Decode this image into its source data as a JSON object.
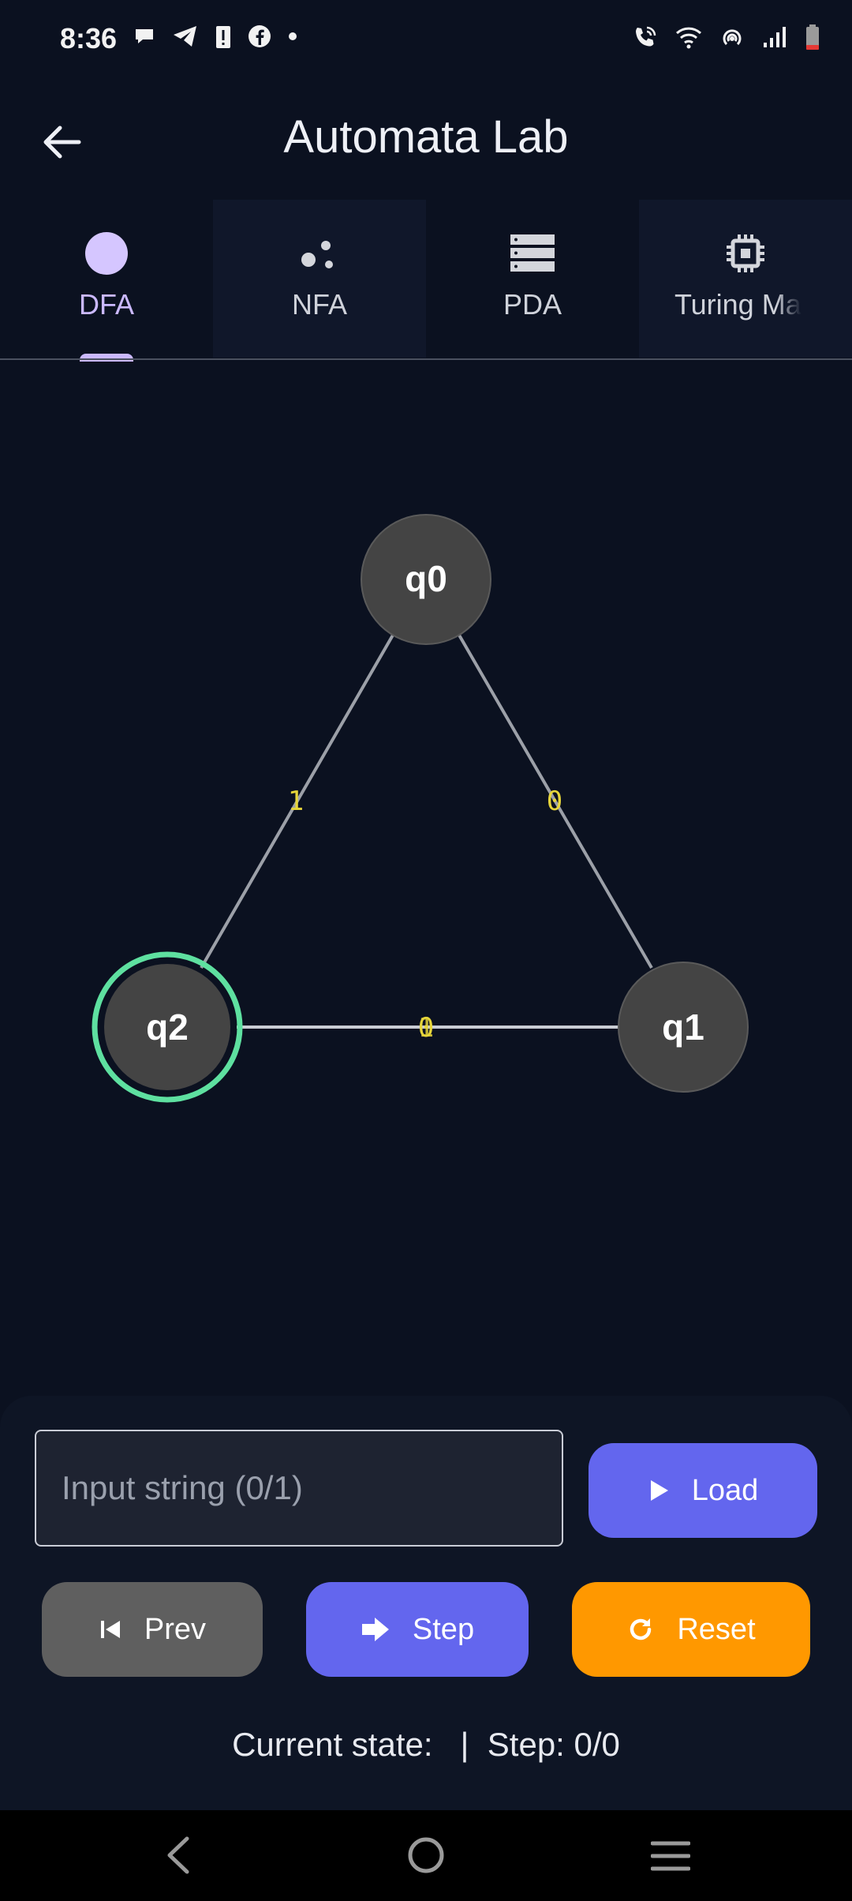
{
  "status_bar": {
    "time": "8:36"
  },
  "app_bar": {
    "title": "Automata Lab"
  },
  "tabs": [
    {
      "label": "DFA",
      "icon": "circle-icon",
      "active": true
    },
    {
      "label": "NFA",
      "icon": "bubbles-icon",
      "active": false
    },
    {
      "label": "PDA",
      "icon": "stack-icon",
      "active": false
    },
    {
      "label": "Turing Ma",
      "icon": "chip-icon",
      "active": false
    }
  ],
  "diagram": {
    "states": [
      {
        "id": "q0",
        "label": "q0",
        "accepting": false
      },
      {
        "id": "q1",
        "label": "q1",
        "accepting": false
      },
      {
        "id": "q2",
        "label": "q2",
        "accepting": true
      }
    ],
    "transitions": [
      {
        "from": "q0",
        "to": "q2",
        "label": "1"
      },
      {
        "from": "q0",
        "to": "q1",
        "label": "0"
      },
      {
        "from": "q1",
        "to": "q2",
        "label": "0"
      },
      {
        "from": "q2",
        "to": "q1",
        "label": "1"
      }
    ]
  },
  "controls": {
    "input_placeholder": "Input string (0/1)",
    "load_label": "Load",
    "prev_label": "Prev",
    "step_label": "Step",
    "reset_label": "Reset",
    "status_text": "Current state:   |  Step: 0/0"
  },
  "colors": {
    "background": "#0b1120",
    "accent": "#6366ee",
    "reset": "#ff9800",
    "accepting_ring": "#5ee0a0",
    "edge_label": "#e6d53a"
  }
}
